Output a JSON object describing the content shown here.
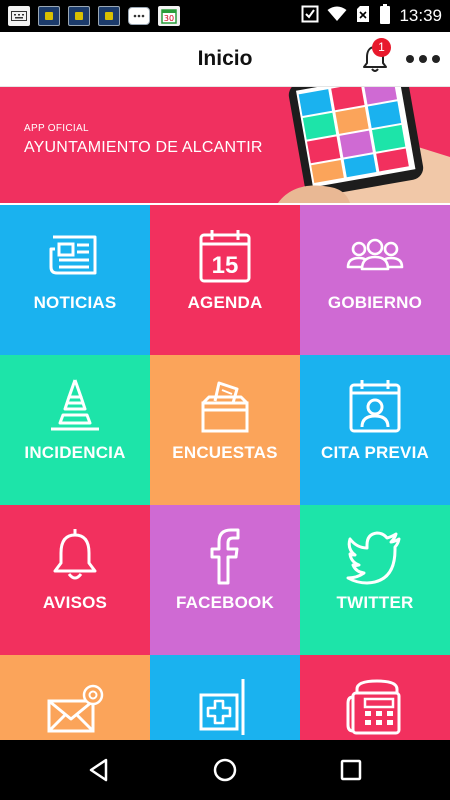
{
  "status_bar": {
    "time": "13:39",
    "icons": [
      "keyboard-icon",
      "app-notification-icon",
      "app-notification-icon",
      "app-notification-icon",
      "chat-icon",
      "calendar-notification-icon",
      "checkbox-icon",
      "wifi-icon",
      "no-sim-icon",
      "battery-icon"
    ]
  },
  "header": {
    "title": "Inicio",
    "notification_count": "1"
  },
  "banner": {
    "subtitle": "APP OFICIAL",
    "title": "AYUNTAMIENTO DE ALCANTIR"
  },
  "calendar_day": "15",
  "tiles": [
    {
      "label": "NOTICIAS",
      "icon": "newspaper-icon",
      "color": "#1ab2ef"
    },
    {
      "label": "AGENDA",
      "icon": "calendar-icon",
      "color": "#f2305e"
    },
    {
      "label": "GOBIERNO",
      "icon": "group-icon",
      "color": "#cf6ad3"
    },
    {
      "label": "INCIDENCIA",
      "icon": "warning-cone-icon",
      "color": "#1de4a9"
    },
    {
      "label": "ENCUESTAS",
      "icon": "ballot-box-icon",
      "color": "#fba45a"
    },
    {
      "label": "CITA PREVIA",
      "icon": "appointment-icon",
      "color": "#1ab2ef"
    },
    {
      "label": "AVISOS",
      "icon": "bell-icon",
      "color": "#f2305e"
    },
    {
      "label": "FACEBOOK",
      "icon": "facebook-icon",
      "color": "#cf6ad3"
    },
    {
      "label": "TWITTER",
      "icon": "twitter-icon",
      "color": "#1de4a9"
    },
    {
      "label": "",
      "icon": "mail-icon",
      "color": "#fba45a"
    },
    {
      "label": "",
      "icon": "health-icon",
      "color": "#1ab2ef"
    },
    {
      "label": "",
      "icon": "phone-icon",
      "color": "#f2305e"
    }
  ],
  "nav": {
    "icons": [
      "back-icon",
      "home-icon",
      "recents-icon"
    ]
  }
}
